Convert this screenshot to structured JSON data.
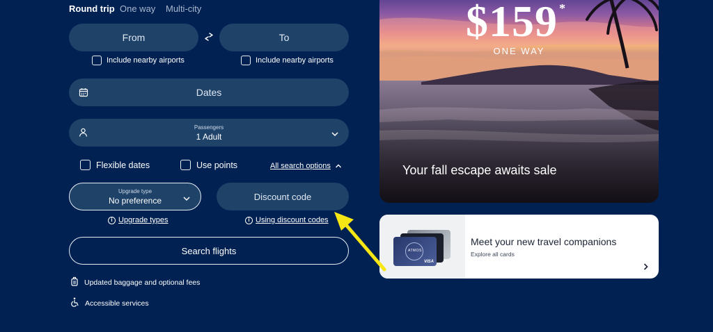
{
  "trip_tabs": [
    {
      "label": "Round trip",
      "active": true
    },
    {
      "label": "One way",
      "active": false
    },
    {
      "label": "Multi-city",
      "active": false
    }
  ],
  "from_field": {
    "placeholder": "From"
  },
  "to_field": {
    "placeholder": "To"
  },
  "swap_icon": "swap-arrows",
  "nearby_from": {
    "label": "Include nearby airports",
    "checked": false
  },
  "nearby_to": {
    "label": "Include nearby airports",
    "checked": false
  },
  "dates_field": {
    "placeholder": "Dates"
  },
  "passengers": {
    "label": "Passengers",
    "value": "1 Adult"
  },
  "options": {
    "flexible_dates": {
      "label": "Flexible dates",
      "checked": false
    },
    "use_points": {
      "label": "Use points",
      "checked": false
    },
    "all_search_options": "All search options"
  },
  "upgrade": {
    "label": "Upgrade type",
    "value": "No preference",
    "help": "Upgrade types"
  },
  "discount": {
    "placeholder": "Discount code",
    "help": "Using discount codes"
  },
  "search_button": "Search flights",
  "footer_links": [
    {
      "label": "Updated baggage and optional fees",
      "icon": "luggage-icon"
    },
    {
      "label": "Accessible services",
      "icon": "accessibility-icon"
    }
  ],
  "hero": {
    "price": "$159",
    "asterisk": "*",
    "trip": "ONE WAY",
    "tagline": "Your fall escape awaits sale"
  },
  "card_promo": {
    "title": "Meet your new travel companions",
    "subtitle": "Explore all cards",
    "card_brand": "ATMOS",
    "card_network": "VISA"
  },
  "colors": {
    "background": "#012152",
    "field": "#1f4269",
    "annotation_arrow": "#f5e614"
  }
}
